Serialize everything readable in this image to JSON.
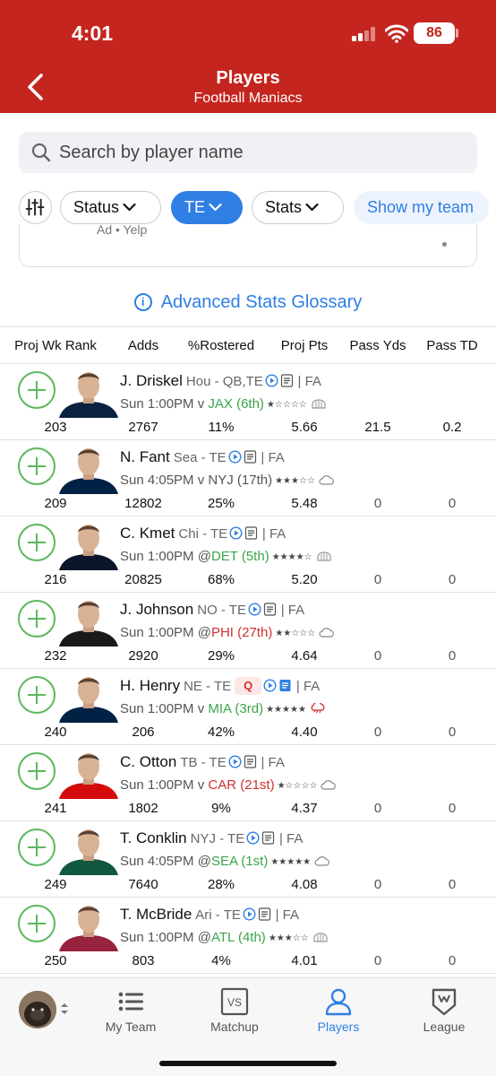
{
  "status": {
    "time": "4:01",
    "battery": "86"
  },
  "header": {
    "title": "Players",
    "subtitle": "Football Maniacs"
  },
  "search": {
    "placeholder": "Search by player name"
  },
  "filters": {
    "status_label": "Status",
    "position_label": "TE",
    "stats_label": "Stats",
    "show_team_label": "Show my team"
  },
  "ad": {
    "text": "Ad • Yelp"
  },
  "glossary": {
    "label": "Advanced Stats Glossary"
  },
  "columns": [
    "Proj Wk Rank",
    "Adds",
    "%Rostered",
    "Proj Pts",
    "Pass Yds",
    "Pass TD"
  ],
  "players": [
    {
      "name": "J. Driskel",
      "team": "Hou - QB,TE",
      "fa": "| FA",
      "game": "Sun 1:00PM v ",
      "opp": "JAX (6th)",
      "opp_tone": "good",
      "stars": "★☆☆☆☆",
      "weather": "dome",
      "badge": "",
      "jersey": "#0b2240",
      "rank": "203",
      "adds": "2767",
      "rostered": "11%",
      "proj": "5.66",
      "pass_yds": "21.5",
      "pass_td": "0.2"
    },
    {
      "name": "N. Fant",
      "team": "Sea - TE",
      "fa": "| FA",
      "game": "Sun 4:05PM v ",
      "opp": "NYJ (17th)",
      "opp_tone": "neutral",
      "stars": "★★★☆☆",
      "weather": "cloud",
      "badge": "",
      "jersey": "#002244",
      "rank": "209",
      "adds": "12802",
      "rostered": "25%",
      "proj": "5.48",
      "pass_yds": "0",
      "pass_td": "0"
    },
    {
      "name": "C. Kmet",
      "team": "Chi - TE",
      "fa": "| FA",
      "game": "Sun 1:00PM @",
      "opp": "DET (5th)",
      "opp_tone": "good",
      "stars": "★★★★☆",
      "weather": "dome",
      "badge": "",
      "jersey": "#0b162a",
      "rank": "216",
      "adds": "20825",
      "rostered": "68%",
      "proj": "5.20",
      "pass_yds": "0",
      "pass_td": "0"
    },
    {
      "name": "J. Johnson",
      "team": "NO - TE",
      "fa": "| FA",
      "game": "Sun 1:00PM @",
      "opp": "PHI (27th)",
      "opp_tone": "bad",
      "stars": "★★☆☆☆",
      "weather": "cloud",
      "badge": "",
      "jersey": "#1a1a1a",
      "rank": "232",
      "adds": "2920",
      "rostered": "29%",
      "proj": "4.64",
      "pass_yds": "0",
      "pass_td": "0"
    },
    {
      "name": "H. Henry",
      "team": "NE - TE",
      "fa": "| FA",
      "game": "Sun 1:00PM v ",
      "opp": "MIA (3rd)",
      "opp_tone": "good",
      "stars": "★★★★★",
      "weather": "storm",
      "badge": "Q",
      "jersey": "#002244",
      "rank": "240",
      "adds": "206",
      "rostered": "42%",
      "proj": "4.40",
      "pass_yds": "0",
      "pass_td": "0"
    },
    {
      "name": "C. Otton",
      "team": "TB - TE",
      "fa": "| FA",
      "game": "Sun 1:00PM v ",
      "opp": "CAR (21st)",
      "opp_tone": "bad",
      "stars": "★☆☆☆☆",
      "weather": "cloud",
      "badge": "",
      "jersey": "#d50a0a",
      "rank": "241",
      "adds": "1802",
      "rostered": "9%",
      "proj": "4.37",
      "pass_yds": "0",
      "pass_td": "0"
    },
    {
      "name": "T. Conklin",
      "team": "NYJ - TE",
      "fa": "| FA",
      "game": "Sun 4:05PM @",
      "opp": "SEA (1st)",
      "opp_tone": "good",
      "stars": "★★★★★",
      "weather": "cloud",
      "badge": "",
      "jersey": "#125740",
      "rank": "249",
      "adds": "7640",
      "rostered": "28%",
      "proj": "4.08",
      "pass_yds": "0",
      "pass_td": "0"
    },
    {
      "name": "T. McBride",
      "team": "Ari - TE",
      "fa": "| FA",
      "game": "Sun 1:00PM @",
      "opp": "ATL (4th)",
      "opp_tone": "good",
      "stars": "★★★☆☆",
      "weather": "dome",
      "badge": "",
      "jersey": "#97233f",
      "rank": "250",
      "adds": "803",
      "rostered": "4%",
      "proj": "4.01",
      "pass_yds": "0",
      "pass_td": "0"
    }
  ],
  "nav": {
    "my_team": "My Team",
    "matchup": "Matchup",
    "matchup_icon_text": "VS",
    "players": "Players",
    "league": "League"
  },
  "colors": {
    "brand_red": "#c4261f",
    "accent_blue": "#2f7fe4",
    "add_green": "#5cb85c",
    "good_green": "#3aa54a",
    "bad_red": "#d32f2f"
  }
}
